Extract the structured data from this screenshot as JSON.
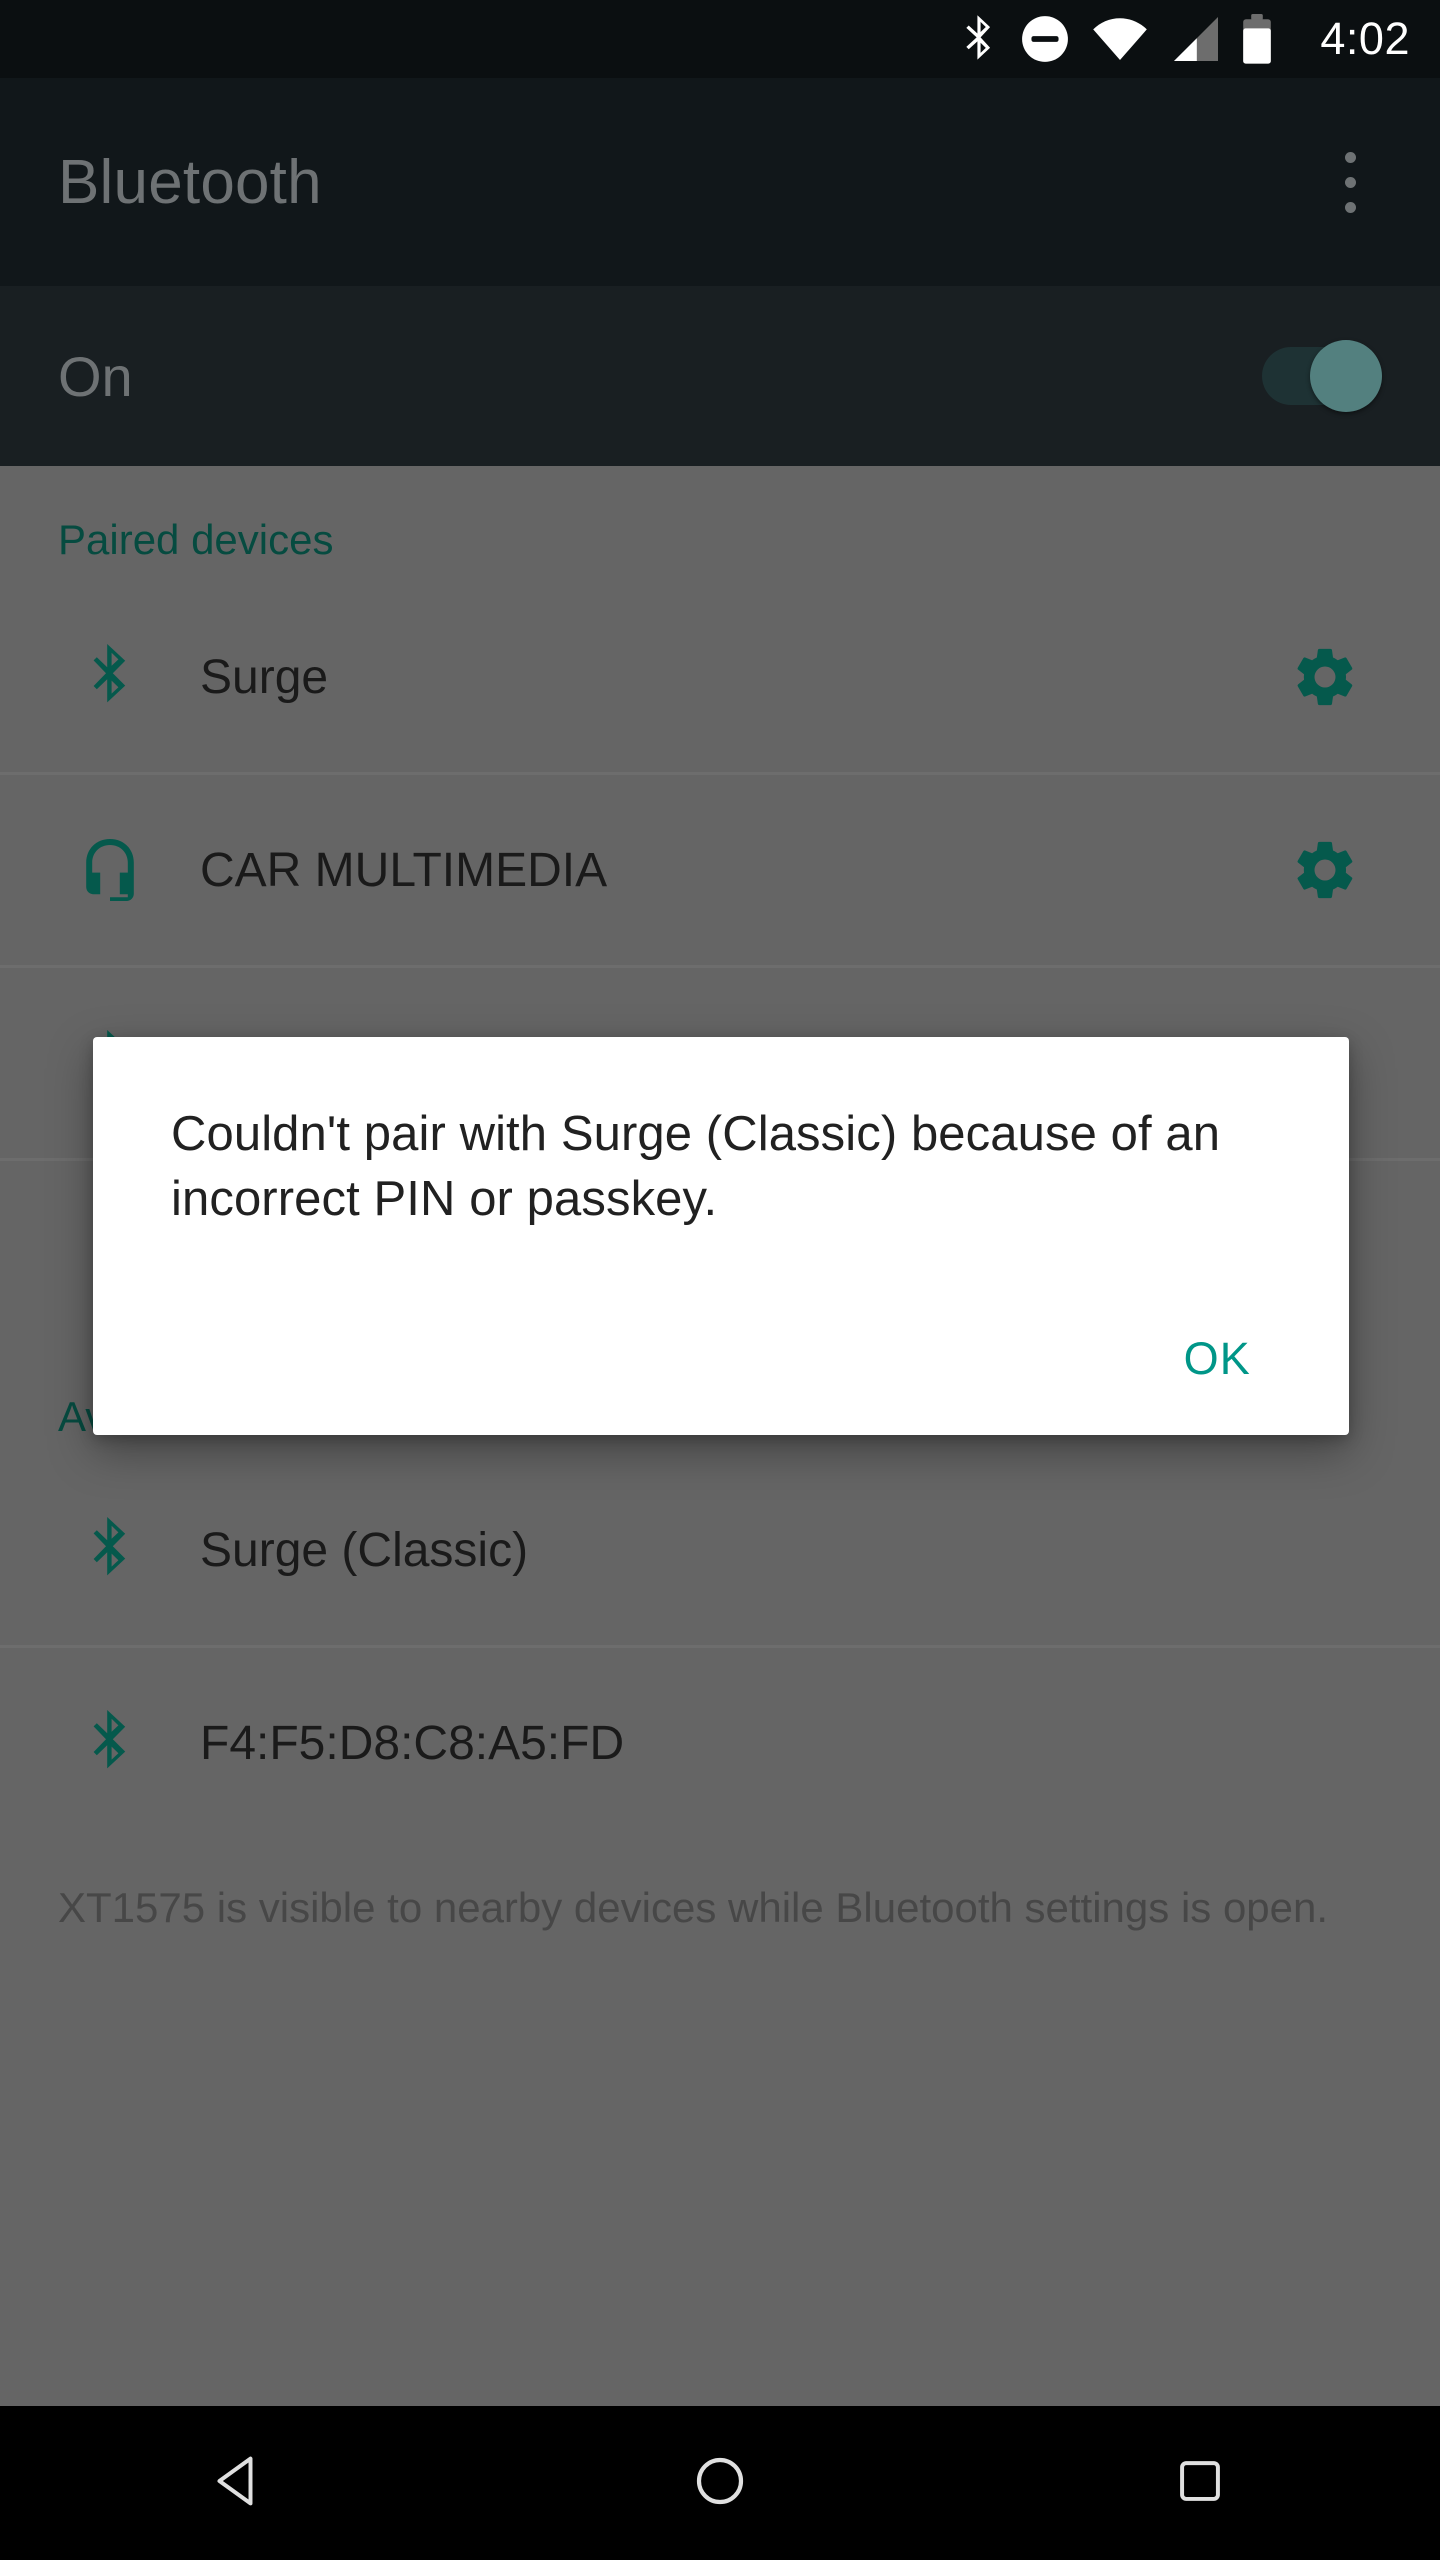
{
  "status_bar": {
    "icons": [
      "bluetooth-icon",
      "do-not-disturb-icon",
      "wifi-icon",
      "cell-signal-icon",
      "battery-icon"
    ],
    "clock": "4:02"
  },
  "app_bar": {
    "title": "Bluetooth",
    "overflow_menu": "more-options"
  },
  "master_toggle": {
    "label": "On",
    "state": "on"
  },
  "sections": [
    {
      "header": "Paired devices",
      "devices": [
        {
          "name": "Surge",
          "icon": "bluetooth-icon",
          "has_settings": true
        },
        {
          "name": "CAR MULTIMEDIA",
          "icon": "headset-icon",
          "has_settings": true
        }
      ]
    },
    {
      "header": "Available devices",
      "devices": [
        {
          "name": "Surge (Classic)",
          "icon": "bluetooth-icon",
          "has_settings": false
        },
        {
          "name": "F4:F5:D8:C8:A5:FD",
          "icon": "bluetooth-icon",
          "has_settings": false
        }
      ]
    }
  ],
  "footer_note": "XT1575 is visible to nearby devices while Bluetooth settings is open.",
  "dialog": {
    "message": "Couldn't pair with Surge (Classic) because of an incorrect PIN or passkey.",
    "ok_label": "OK"
  },
  "nav_bar": {
    "back": "back-icon",
    "home": "home-icon",
    "recents": "recents-icon"
  },
  "colors": {
    "accent_teal": "#009688",
    "section_header_teal": "#064b40",
    "status_bar_bg": "#0b0f11",
    "app_bar_bg": "#11171a",
    "toggle_row_bg": "#191f22",
    "scrim_bg": "#656565",
    "dialog_bg": "#ffffff",
    "nav_bar_bg": "#000000"
  }
}
